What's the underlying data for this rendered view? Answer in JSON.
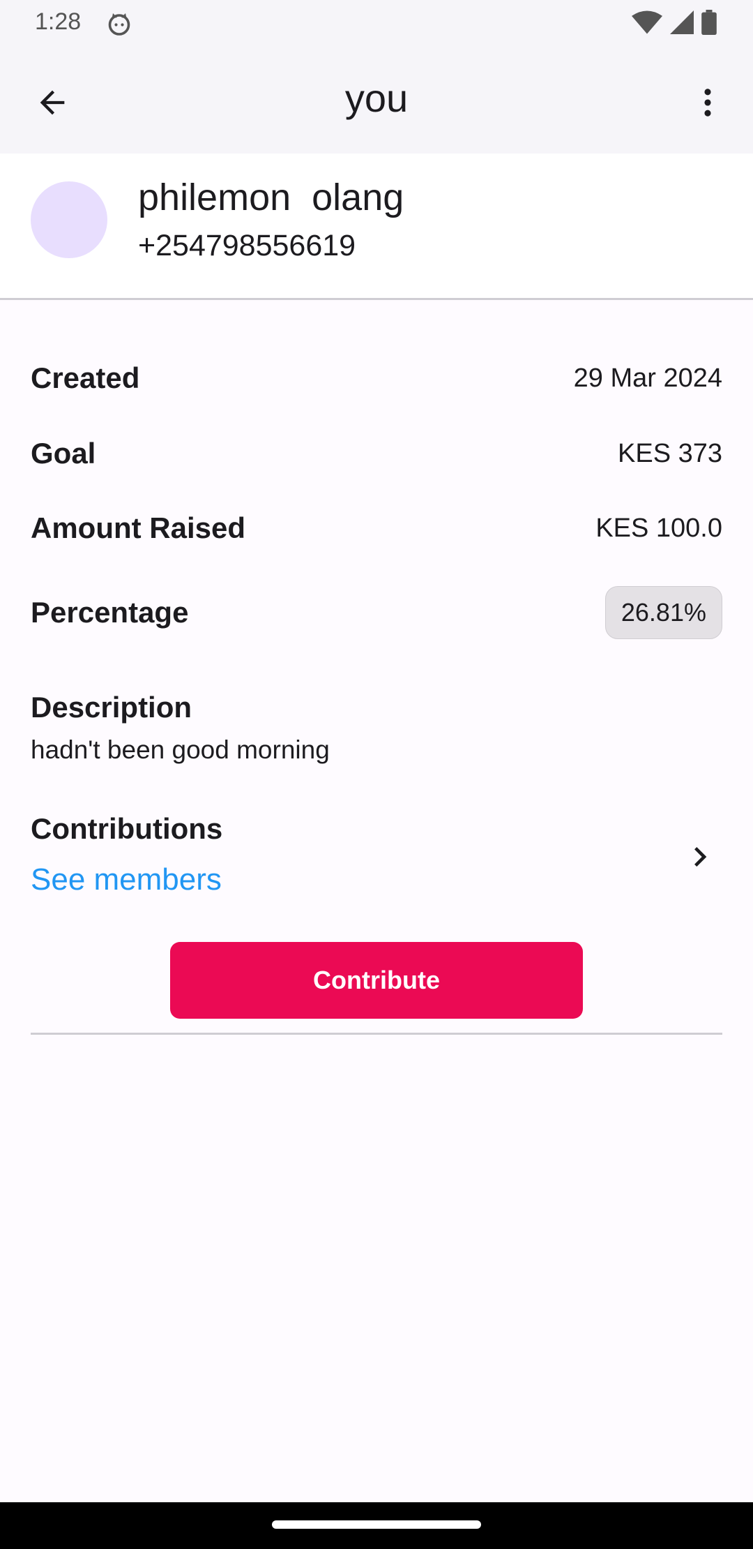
{
  "status_bar": {
    "time": "1:28",
    "icons": [
      "cat-icon",
      "wifi-icon",
      "signal-icon",
      "battery-icon"
    ]
  },
  "app_bar": {
    "title": "you",
    "back_icon": "arrow-back-icon",
    "menu_icon": "more-vert-icon"
  },
  "profile": {
    "name": "philemon  olang",
    "phone": "+254798556619",
    "avatar_color": "#e8defe"
  },
  "details": {
    "created_label": "Created",
    "created_value": "29 Mar 2024",
    "goal_label": "Goal",
    "goal_value": "KES 373",
    "raised_label": "Amount Raised",
    "raised_value": "KES 100.0",
    "percentage_label": "Percentage",
    "percentage_value": "26.81%"
  },
  "description": {
    "label": "Description",
    "text": "hadn't been good morning"
  },
  "contributions": {
    "label": "Contributions",
    "link": "See members"
  },
  "actions": {
    "contribute_label": "Contribute"
  },
  "colors": {
    "accent": "#eb0a54",
    "link": "#2196f3",
    "chip_bg": "#e4e1e5"
  }
}
